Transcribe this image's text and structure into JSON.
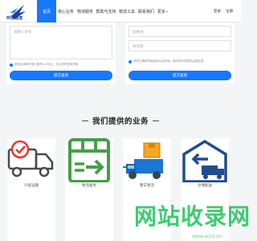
{
  "header": {
    "logo_text": "环球物流",
    "nav": [
      "首页",
      "核心业务",
      "物流服务",
      "帮助与支持",
      "物流工具",
      "联系我们",
      "更多"
    ],
    "active_index": 0,
    "more_caret": "⌄",
    "right_links": [
      "登录",
      "注册"
    ],
    "brand_color": "#1677ff"
  },
  "form_left": {
    "textarea_placeholder": "请输入单号",
    "note": "例如运单单号或订单号(1-20位)，可以同时查询多单",
    "submit": "提交查询"
  },
  "form_right": {
    "field1_placeholder": "起始地",
    "field2_placeholder": "目的地",
    "note": "请您正确填写起始地与目的地，我们将为您提供运费估算",
    "submit": "提交查询"
  },
  "section": {
    "title": "我们提供的业务"
  },
  "services": [
    {
      "name": "冷链运输",
      "icon": "truck-check-icon"
    },
    {
      "name": "物流服务",
      "icon": "box-arrow-icon"
    },
    {
      "name": "整车物流",
      "icon": "delivery-truck-icon"
    },
    {
      "name": "仓储配送",
      "icon": "warehouse-truck-icon"
    }
  ],
  "watermark": {
    "text": "网站收录网",
    "url": "www.wzsl.cn"
  }
}
